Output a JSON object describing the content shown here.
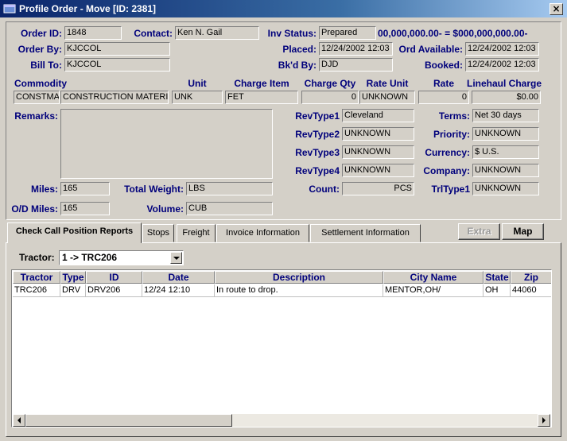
{
  "window": {
    "title": "Profile Order - Move [ID: 2381]"
  },
  "header": {
    "order_id_label": "Order ID:",
    "order_id": "1848",
    "contact_label": "Contact:",
    "contact": "Ken N. Gail",
    "inv_status_label": "Inv Status:",
    "inv_status": "Prepared",
    "balance_text": "00,000,000.00- = $000,000,000.00-",
    "order_by_label": "Order By:",
    "order_by": "KJCCOL",
    "placed_label": "Placed:",
    "placed": "12/24/2002 12:03",
    "ord_available_label": "Ord Available:",
    "ord_available": "12/24/2002 12:03",
    "bill_to_label": "Bill To:",
    "bill_to": "KJCCOL",
    "bkd_by_label": "Bk'd By:",
    "bkd_by": "DJD",
    "booked_label": "Booked:",
    "booked": "12/24/2002 12:03"
  },
  "commodity": {
    "headers": {
      "commodity": "Commodity",
      "unit": "Unit",
      "charge_item": "Charge Item",
      "charge_qty": "Charge Qty",
      "rate_unit": "Rate Unit",
      "rate": "Rate",
      "linehaul_charge": "Linehaul Charge"
    },
    "code": "CONSTMA",
    "description": "CONSTRUCTION MATERIA",
    "unit": "UNK",
    "charge_item": "FET",
    "charge_qty": "0",
    "rate_unit": "UNKNOWN",
    "rate": "0",
    "linehaul_charge": "$0.00"
  },
  "details": {
    "remarks_label": "Remarks:",
    "remarks": "",
    "revtype1_label": "RevType1",
    "revtype1": "Cleveland",
    "revtype2_label": "RevType2",
    "revtype2": "UNKNOWN",
    "revtype3_label": "RevType3",
    "revtype3": "UNKNOWN",
    "revtype4_label": "RevType4",
    "revtype4": "UNKNOWN",
    "terms_label": "Terms:",
    "terms": "Net 30 days",
    "priority_label": "Priority:",
    "priority": "UNKNOWN",
    "currency_label": "Currency:",
    "currency": "$ U.S.",
    "company_label": "Company:",
    "company": "UNKNOWN",
    "count_label": "Count:",
    "count": "PCS",
    "trltype1_label": "TrlType1",
    "trltype1": "UNKNOWN",
    "miles_label": "Miles:",
    "miles": "165",
    "od_miles_label": "O/D Miles:",
    "od_miles": "165",
    "total_weight_label": "Total Weight:",
    "total_weight": "LBS",
    "volume_label": "Volume:",
    "volume": "CUB"
  },
  "tabs": [
    {
      "label": "Check Call Position Reports",
      "active": true
    },
    {
      "label": "Stops"
    },
    {
      "label": "Freight"
    },
    {
      "label": "Invoice Information"
    },
    {
      "label": "Settlement Information"
    }
  ],
  "buttons": {
    "extra": "Extra",
    "map": "Map"
  },
  "tractor": {
    "label": "Tractor:",
    "selected": "1 -> TRC206"
  },
  "grid": {
    "columns": [
      "Tractor",
      "Type",
      "ID",
      "Date",
      "Description",
      "City Name",
      "State",
      "Zip"
    ],
    "rows": [
      [
        "TRC206",
        "DRV",
        "DRV206",
        "12/24 12:10",
        "In route to drop.",
        "MENTOR,OH/",
        "OH",
        "44060"
      ]
    ]
  }
}
